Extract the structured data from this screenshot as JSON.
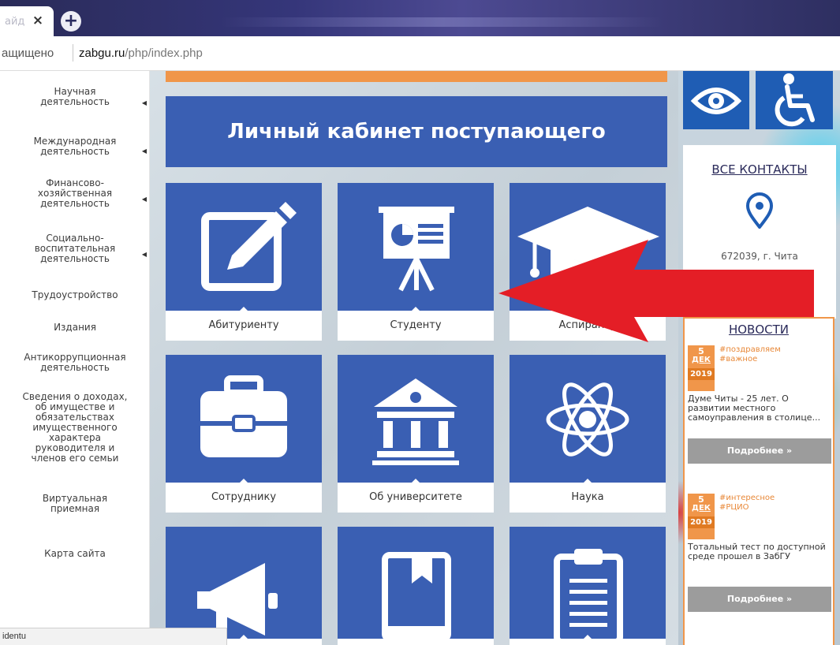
{
  "browser": {
    "tab_title_fragment": "айд",
    "tab_close_label": "×",
    "new_tab_label": "+",
    "address": {
      "security_text": "ащищено",
      "host": "zabgu.ru",
      "path": "/php/index.php"
    },
    "status_url": "identu"
  },
  "sidebar": {
    "items": [
      {
        "label": "Научная\nдеятельность",
        "has_arrow": true
      },
      {
        "label": "Международная\nдеятельность",
        "has_arrow": true
      },
      {
        "label": "Финансово-\nхозяйственная\nдеятельность",
        "has_arrow": true
      },
      {
        "label": "Социально-\nвоспитательная\nдеятельность",
        "has_arrow": true
      },
      {
        "label": "Трудоустройство",
        "has_arrow": false
      },
      {
        "label": "Издания",
        "has_arrow": false
      },
      {
        "label": "Антикоррупционная\nдеятельность",
        "has_arrow": false
      },
      {
        "label": "Сведения о доходах,\nоб имуществе и\nобязательствах\nимущественного\nхарактера\nруководителя и\nчленов его семьи",
        "has_arrow": false
      },
      {
        "label": "Виртуальная\nприемная",
        "has_arrow": false
      },
      {
        "label": "Карта сайта",
        "has_arrow": false
      }
    ]
  },
  "main": {
    "banner_label": "Личный кабинет поступающего",
    "tiles": [
      {
        "label": "Абитуриенту",
        "icon": "edit-icon"
      },
      {
        "label": "Студенту",
        "icon": "presentation-icon"
      },
      {
        "label": "Аспиранту",
        "icon": "graduation-cap-icon"
      },
      {
        "label": "Сотруднику",
        "icon": "briefcase-icon"
      },
      {
        "label": "Об университете",
        "icon": "university-icon"
      },
      {
        "label": "Наука",
        "icon": "atom-icon"
      },
      {
        "label": "",
        "icon": "megaphone-icon"
      },
      {
        "label": "",
        "icon": "book-icon"
      },
      {
        "label": "",
        "icon": "clipboard-icon"
      }
    ]
  },
  "right": {
    "contacts_title": "ВСЕ КОНТАКТЫ",
    "contacts_address": "672039, г. Чита",
    "news_title": "НОВОСТИ",
    "news": [
      {
        "day": "5",
        "month": "ДЕК",
        "year": "2019",
        "tags": [
          "#поздравляем",
          "#важное"
        ],
        "text": "Думе Читы - 25 лет. О развитии местного самоуправления в столице...",
        "more_label": "Подробнее »"
      },
      {
        "day": "5",
        "month": "ДЕК",
        "year": "2019",
        "tags": [
          "#интересное",
          "#РЦИО"
        ],
        "text": "Тотальный тест по доступной среде прошел в ЗабГУ",
        "more_label": "Подробнее »"
      }
    ]
  },
  "colors": {
    "tile_blue": "#3a5fb3",
    "accent_orange": "#f0964a",
    "accessibility_blue": "#1f5db4",
    "annotation_red": "#e41e26"
  }
}
